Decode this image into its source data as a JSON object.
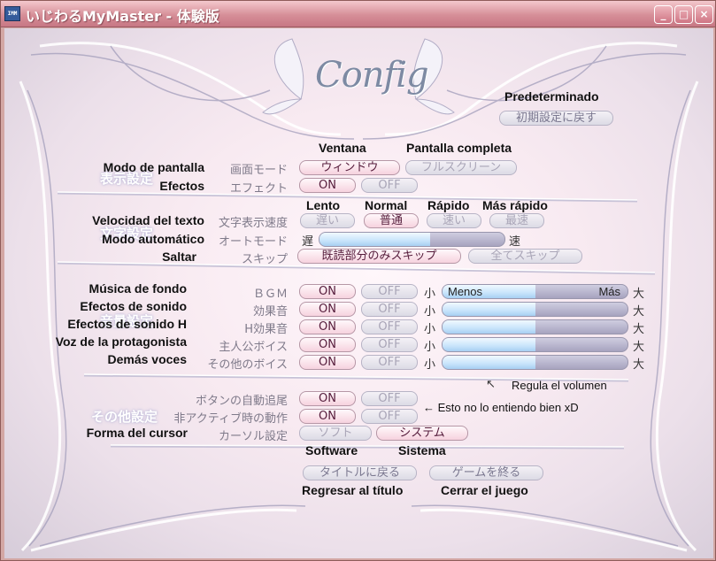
{
  "window": {
    "title": "いじわるMyMaster - 体験版",
    "icon": "app-icon",
    "min": "minimize-icon",
    "max": "maximize-icon",
    "close": "close-icon"
  },
  "header": {
    "title": "Config",
    "default_label": "Predeterminado",
    "default_button": "初期設定に戻す"
  },
  "display": {
    "ghost": "表示設定",
    "col_window": "Ventana",
    "col_fullscreen": "Pantalla completa",
    "screen_mode": {
      "label": "Modo de pantalla",
      "jp": "画面モード",
      "opt1": "ウィンドウ",
      "opt2": "フルスクリーン",
      "selected": "ウィンドウ"
    },
    "effects": {
      "label": "Efectos",
      "jp": "エフェクト",
      "opt1": "ON",
      "opt2": "OFF",
      "selected": "ON"
    }
  },
  "text": {
    "ghost": "文字設定",
    "col_slow": "Lento",
    "col_normal": "Normal",
    "col_fast": "Rápido",
    "col_fastest": "Más rápido",
    "speed": {
      "label": "Velocidad del texto",
      "jp": "文字表示速度",
      "opts": [
        "遅い",
        "普通",
        "速い",
        "最速"
      ],
      "selected": "普通"
    },
    "auto": {
      "label": "Modo automático",
      "jp": "オートモード",
      "slow": "遅",
      "fast": "速",
      "level": 0.6
    },
    "skip": {
      "label": "Saltar",
      "jp": "スキップ",
      "opt1": "既読部分のみスキップ",
      "opt2": "全てスキップ",
      "selected": "既読部分のみスキップ"
    }
  },
  "sound": {
    "ghost": "音量設定",
    "small": "小",
    "big": "大",
    "less": "Menos",
    "more": "Más",
    "rows": [
      {
        "label": "Música de fondo",
        "jp": "ＢＧＭ",
        "on": "ON",
        "off": "OFF",
        "selected": "ON",
        "level": 0.5
      },
      {
        "label": "Efectos de sonido",
        "jp": "効果音",
        "on": "ON",
        "off": "OFF",
        "selected": "ON",
        "level": 0.5
      },
      {
        "label": "Efectos de sonido H",
        "jp": "H効果音",
        "on": "ON",
        "off": "OFF",
        "selected": "ON",
        "level": 0.5
      },
      {
        "label": "Voz de la protagonista",
        "jp": "主人公ボイス",
        "on": "ON",
        "off": "OFF",
        "selected": "ON",
        "level": 0.5
      },
      {
        "label": "Demás voces",
        "jp": "その他のボイス",
        "on": "ON",
        "off": "OFF",
        "selected": "ON",
        "level": 0.5
      }
    ],
    "note": "Regula el volumen"
  },
  "other": {
    "ghost": "その他設定",
    "autofollow": {
      "jp": "ボタンの自動追尾",
      "on": "ON",
      "off": "OFF",
      "selected": "ON"
    },
    "inactive": {
      "jp": "非アクティブ時の動作",
      "on": "ON",
      "off": "OFF",
      "selected": "ON",
      "note": "← Esto no lo entiendo bien xD"
    },
    "cursor": {
      "label": "Forma del cursor",
      "jp": "カーソル設定",
      "opt1": "ソフト",
      "opt2": "システム",
      "selected": "システム",
      "caption1": "Software",
      "caption2": "Sistema"
    }
  },
  "footer": {
    "title_button": "タイトルに戻る",
    "title_caption": "Regresar al título",
    "exit_button": "ゲームを終る",
    "exit_caption": "Cerrar el juego"
  },
  "colors": {
    "titlebar": "#d68f98",
    "panel": "#f8eaf1",
    "on_text": "#551c3b",
    "off_text": "#a9a5b7",
    "fill": "#c8e4fb"
  }
}
